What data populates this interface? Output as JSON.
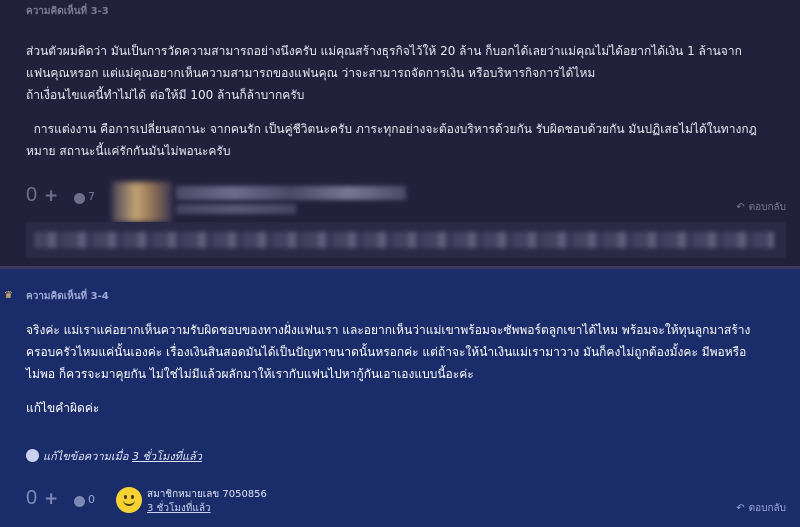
{
  "comment_33": {
    "label": "ความคิดเห็นที่ 3-3",
    "paragraph1": "ส่วนตัวผมคิดว่า มันเป็นการวัดความสามารถอย่างนึงครับ แม่คุณสร้างธุรกิจไว้ให้ 20 ล้าน ก็บอกได้เลยว่าแม่คุณไม่ได้อยากได้เงิน 1 ล้านจาก\nแฟนคุณหรอก แต่แม่คุณอยากเห็นความสามารถของแฟนคุณ ว่าจะสามารถจัดการเงิน หรือบริหารกิจการได้ไหม\nถ้าเงื่อนไขแค่นี้ทำไม่ได้ ต่อให้มี 100 ล้านก็ล้าบากครับ",
    "paragraph2": "  การแต่งงาน คือการเปลี่ยนสถานะ จากคนรัก เป็นคู่ชีวิตนะครับ ภาระทุกอย่างจะต้องบริหารด้วยกัน รับผิดชอบด้วยกัน มันปฏิเสธไม่ได้ในทางกฎ\nหมาย สถานะนี้แค่รักกันมันไม่พอนะครับ",
    "vote_count": "0",
    "vote_plus": "+",
    "emotion_count": "7",
    "reply_label": "ตอบกลับ"
  },
  "comment_34": {
    "label": "ความคิดเห็นที่ 3-4",
    "paragraph1": "จริงค่ะ แม่เราแค่อยากเห็นความรับผิดชอบของทางฝั่งแฟนเรา และอยากเห็นว่าแม่เขาพร้อมจะซัพพอร์ตลูกเขาได้ไหม พร้อมจะให้ทุนลูกมาสร้าง\nครอบครัวไหมแค่นั้นเองค่ะ เรื่องเงินสินสอดมันได้เป็นปัญหาขนาดนั้นหรอกค่ะ แต่ถ้าจะให้นำเงินแม่เรามาวาง มันก็คงไม่ถูกต้องมั้งคะ มีพอหรือ\nไม่พอ ก็ควรจะมาคุยกัน ไม่ใช่ไม่มีแล้วผลักมาให้เรากับแฟนไปหากู้กันเอาเองแบบนี้อะค่ะ",
    "paragraph2": "แก้ไขคำผิดค่ะ",
    "edit_prefix": "แก้ไขข้อความเมื่อ ",
    "edit_time": "3 ชั่วโมงที่แล้ว",
    "vote_count": "0",
    "vote_plus": "+",
    "emotion_count": "0",
    "member_name": "สมาชิกหมายเลข 7050856",
    "member_time": "3 ชั่วโมงที่แล้ว",
    "reply_label": "ตอบกลับ"
  },
  "colors": {
    "page_bg": "#22213c",
    "highlight_bg": "#1a2c6a",
    "text": "#e8e8f2",
    "muted": "#7b7a96"
  },
  "icons": [
    "plus-icon",
    "emotion-icon",
    "reply-icon",
    "edit-icon",
    "owner-icon",
    "avatar-smiley-icon"
  ]
}
